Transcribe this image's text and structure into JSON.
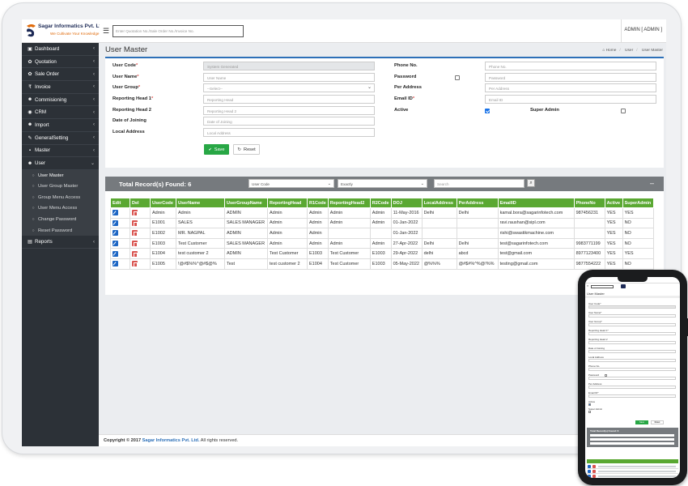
{
  "app": {
    "brand": "Sagar Informatics Pvt. Ltd.",
    "tagline": "We Cultivate Your Knowledge",
    "search_placeholder": "Enter Quotation No./Sale Order No./Invoice No.",
    "user": "ADMIN [ ADMIN ]"
  },
  "sidebar": {
    "items": [
      {
        "label": "Dashboard",
        "icon": "dashboard-icon",
        "glyph": "▣"
      },
      {
        "label": "Quotation",
        "icon": "gear-icon",
        "glyph": "✿"
      },
      {
        "label": "Sale Order",
        "icon": "gear-icon",
        "glyph": "✿"
      },
      {
        "label": "Invoice",
        "icon": "rupee-icon",
        "glyph": "₹"
      },
      {
        "label": "Commisioning",
        "icon": "user-icon",
        "glyph": "☻"
      },
      {
        "label": "CRM",
        "icon": "chat-icon",
        "glyph": "◉"
      },
      {
        "label": "Import",
        "icon": "user-icon",
        "glyph": "☻"
      },
      {
        "label": "GeneralSetting",
        "icon": "wrench-icon",
        "glyph": "✎"
      },
      {
        "label": "Master",
        "icon": "briefcase-icon",
        "glyph": "▪"
      },
      {
        "label": "User",
        "icon": "user-icon",
        "glyph": "☻"
      }
    ],
    "user_sub": [
      {
        "label": "User Master"
      },
      {
        "label": "User Group Master"
      },
      {
        "label": "Group Menu Access"
      },
      {
        "label": "User Menu Access"
      },
      {
        "label": "Change Password"
      },
      {
        "label": "Reset Password"
      }
    ],
    "reports": {
      "label": "Reports",
      "icon": "chart-icon",
      "glyph": "▤"
    }
  },
  "page": {
    "title": "User Master",
    "breadcrumb": [
      "Home",
      "User",
      "User Master"
    ]
  },
  "form": {
    "left": [
      {
        "label": "User Code",
        "req": "*",
        "value": "System Generated",
        "readonly": true
      },
      {
        "label": "User Name",
        "req": "*",
        "value": "User Name"
      },
      {
        "label": "User Group",
        "req": "*",
        "value": "--Select--",
        "select": true
      },
      {
        "label": "Reporting Head 1",
        "req": "*",
        "value": "Reporting Head"
      },
      {
        "label": "Reporting Head 2",
        "req": "",
        "value": "Reporting Head 2"
      },
      {
        "label": "Date of Joining",
        "req": "",
        "value": "Date of Joining"
      },
      {
        "label": "Local Address",
        "req": "",
        "value": "Local Address"
      }
    ],
    "right": [
      {
        "label": "Phone No.",
        "value": "Phone No."
      },
      {
        "label": "Password",
        "value": "Password"
      },
      {
        "label": "Per Address",
        "value": "Per Address"
      },
      {
        "label": "Email ID",
        "req": "*",
        "value": "Email ID"
      },
      {
        "label": "Active"
      }
    ],
    "super_admin": "Super Admin",
    "save": "Save",
    "reset": "Reset"
  },
  "records": {
    "title": "Total Record(s) Found: 6",
    "filter_field": "User Code",
    "filter_mode": "Exactly",
    "search_placeholder": "Search",
    "columns": [
      "Edit",
      "Del",
      "UserCode",
      "UserName",
      "UserGroupName",
      "ReportingHead",
      "R1Code",
      "ReportingHead2",
      "R2Code",
      "DOJ",
      "LocalAddress",
      "PerAddress",
      "EmailID",
      "PhoneNo",
      "Active",
      "SuperAdmin"
    ],
    "rows": [
      [
        "",
        "",
        "Admin",
        "Admin",
        "ADMIN",
        "Admin",
        "Admin",
        "Admin",
        "Admin",
        "11-May-2016",
        "Delhi",
        "Delhi",
        "kamal.bora@sagarinfotech.com",
        "987456231",
        "YES",
        "YES"
      ],
      [
        "",
        "",
        "E1001",
        "SALES",
        "SALES MANAGER",
        "Admin",
        "Admin",
        "Admin",
        "Admin",
        "01-Jan-2022",
        "",
        "",
        "ravi.raushan@sipl.com",
        "",
        "YES",
        "NO"
      ],
      [
        "",
        "",
        "E1002",
        "MR. NAGPAL",
        "ADMIN",
        "Admin",
        "Admin",
        "",
        "",
        "01-Jan-2022",
        "",
        "",
        "rishi@swastikmachine.com",
        "",
        "YES",
        "NO"
      ],
      [
        "",
        "",
        "E1003",
        "Test Customer",
        "SALES MANAGER",
        "Admin",
        "Admin",
        "Admin",
        "Admin",
        "27-Apr-2022",
        "Delhi",
        "Delhi",
        "test@sagarinfotech.com",
        "9983771199",
        "YES",
        "NO"
      ],
      [
        "",
        "",
        "E1004",
        "test customer 2",
        "ADMIN",
        "Test Customer",
        "E1003",
        "Test Customer",
        "E1003",
        "29-Apr-2022",
        "delhi",
        "abcd",
        "test@gmail.com",
        "8977123400",
        "YES",
        "YES"
      ],
      [
        "",
        "",
        "E1005",
        "!@#$%%^@#$@%",
        "Test",
        "test customer 2",
        "E1004",
        "Test Customer",
        "E1003",
        "05-May-2022",
        "@%%%",
        "@#$#%^%@!%%",
        "testing@gmail.com",
        "9877554222",
        "YES",
        "NO"
      ]
    ]
  },
  "footer": {
    "prefix": "Copyright © 2017",
    "company": "Sagar Informatics Pvt. Ltd.",
    "suffix": "All rights reserved."
  },
  "mobile": {
    "title": "User Master",
    "labels": [
      "User Code*",
      "User Name*",
      "User Group*",
      "Reporting Head 1*",
      "Reporting Head 2",
      "Date of Joining",
      "Local Address",
      "Phone No.",
      "Password",
      "Per Address",
      "Email ID*",
      "Active",
      "Super Admin"
    ],
    "records": "Total Record(s) Found: 6",
    "save": "Save",
    "reset": "Reset"
  },
  "colors": {
    "accent": "#2d70b8",
    "grid_header": "#5aa832",
    "sidebar": "#2c3137",
    "save": "#28a745",
    "delete": "#d9534f",
    "edit": "#1d66c4"
  }
}
